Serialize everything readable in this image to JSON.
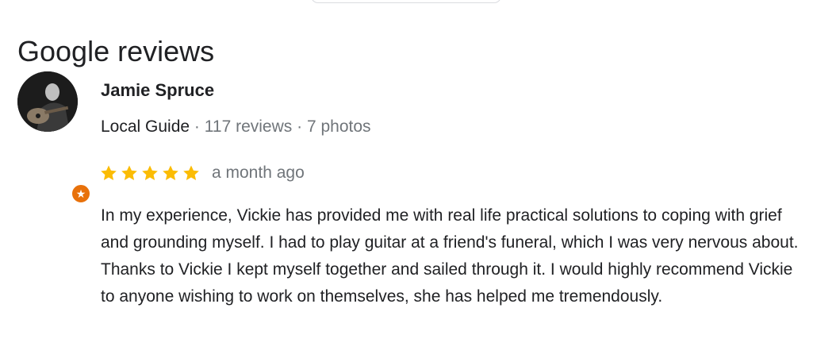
{
  "section": {
    "title": "Google reviews"
  },
  "review": {
    "reviewer": {
      "name": "Jamie Spruce",
      "badge": "Local Guide",
      "separator": "·",
      "reviews_count": "117 reviews",
      "photos_count": "7 photos",
      "avatar_icon": "avatar-photo",
      "badge_icon": "local-guide-star-icon"
    },
    "rating": {
      "stars": 5,
      "max_stars": 5,
      "date": "a month ago"
    },
    "text": "In my experience, Vickie has provided me with real life practical solutions to coping with grief and grounding myself. I had to play guitar at a friend's funeral, which I was very nervous about. Thanks to Vickie I kept myself together and sailed through it. I would highly recommend Vickie to anyone wishing to work on themselves, she has helped me tremendously."
  },
  "colors": {
    "star": "#fbbc04",
    "guide_badge": "#e8710a",
    "text_primary": "#202124",
    "text_secondary": "#70757a"
  }
}
